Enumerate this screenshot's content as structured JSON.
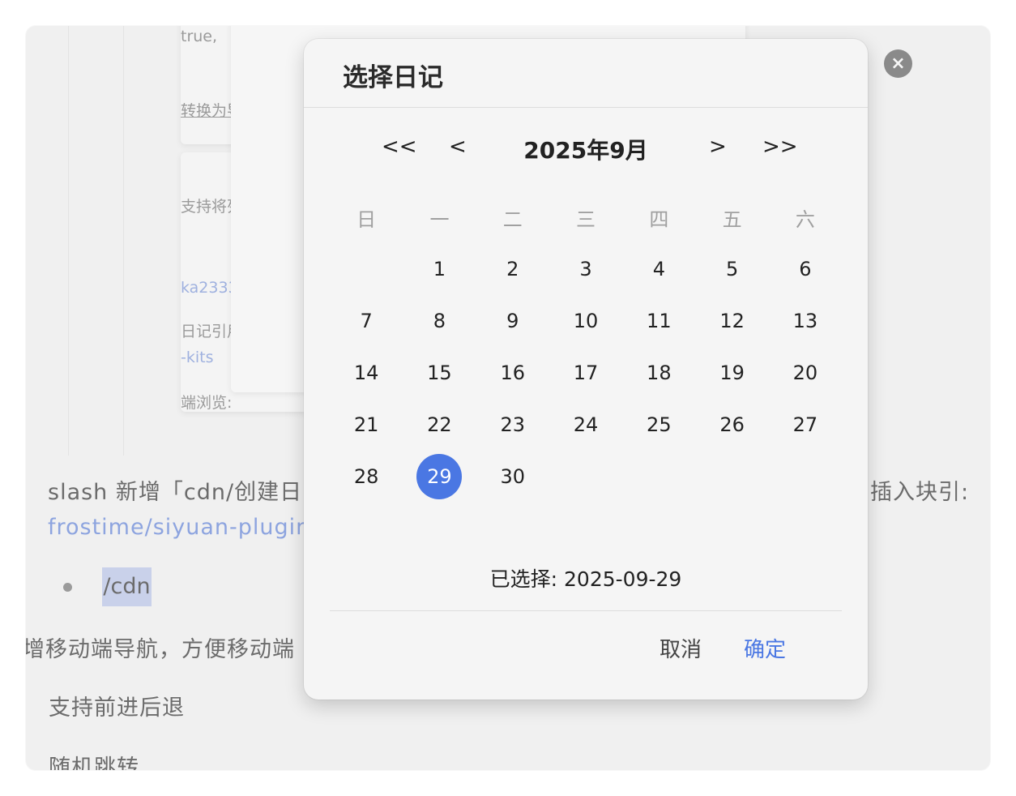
{
  "background": {
    "card_lines": [
      "true,",
      "转换为导",
      "支持将列",
      "ka2333",
      "日记引用",
      "-kits",
      "端浏览:"
    ],
    "doc_lines": {
      "slash_line": "slash 新增「cdn/创建日",
      "right_fragment": "插入块引:",
      "link_line": "frostime/siyuan-plugin-",
      "bullet_item": "/cdn",
      "nav_line": "增移动端导航，方便移动端",
      "support_line": "支持前进后退",
      "random_line": "随机跳转"
    }
  },
  "close_icon": "×",
  "dialog": {
    "title": "选择日记",
    "nav": {
      "prev_year": "<<",
      "prev_month": "<",
      "next_month": ">",
      "next_year": ">>"
    },
    "month_label": "2025年9月",
    "weekdays": [
      "日",
      "一",
      "二",
      "三",
      "四",
      "五",
      "六"
    ],
    "weeks": [
      [
        "",
        "1",
        "2",
        "3",
        "4",
        "5",
        "6"
      ],
      [
        "7",
        "8",
        "9",
        "10",
        "11",
        "12",
        "13"
      ],
      [
        "14",
        "15",
        "16",
        "17",
        "18",
        "19",
        "20"
      ],
      [
        "21",
        "22",
        "23",
        "24",
        "25",
        "26",
        "27"
      ],
      [
        "28",
        "29",
        "30",
        "",
        "",
        "",
        ""
      ]
    ],
    "selected_day": "29",
    "selected_text": "已选择: 2025-09-29",
    "cancel_label": "取消",
    "ok_label": "确定"
  },
  "colors": {
    "accent": "#4a77e3",
    "link": "#8da4df",
    "highlight": "#c9d1ea"
  }
}
